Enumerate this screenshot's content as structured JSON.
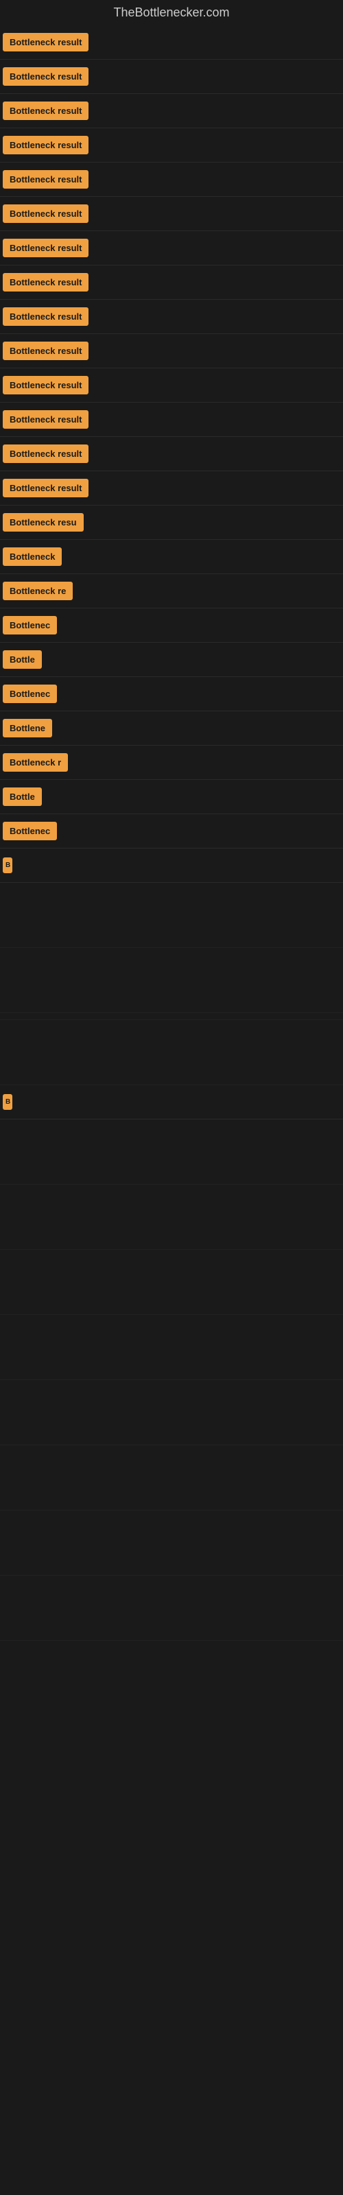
{
  "site": {
    "title": "TheBottlenecker.com"
  },
  "rows": [
    {
      "id": 1,
      "label": "Bottleneck result",
      "badgeClass": "badge-full",
      "spacing": "normal"
    },
    {
      "id": 2,
      "label": "Bottleneck result",
      "badgeClass": "badge-full",
      "spacing": "normal"
    },
    {
      "id": 3,
      "label": "Bottleneck result",
      "badgeClass": "badge-full",
      "spacing": "normal"
    },
    {
      "id": 4,
      "label": "Bottleneck result",
      "badgeClass": "badge-full",
      "spacing": "normal"
    },
    {
      "id": 5,
      "label": "Bottleneck result",
      "badgeClass": "badge-full",
      "spacing": "normal"
    },
    {
      "id": 6,
      "label": "Bottleneck result",
      "badgeClass": "badge-full",
      "spacing": "normal"
    },
    {
      "id": 7,
      "label": "Bottleneck result",
      "badgeClass": "badge-full",
      "spacing": "normal"
    },
    {
      "id": 8,
      "label": "Bottleneck result",
      "badgeClass": "badge-full",
      "spacing": "normal"
    },
    {
      "id": 9,
      "label": "Bottleneck result",
      "badgeClass": "badge-full",
      "spacing": "normal"
    },
    {
      "id": 10,
      "label": "Bottleneck result",
      "badgeClass": "badge-full",
      "spacing": "normal"
    },
    {
      "id": 11,
      "label": "Bottleneck result",
      "badgeClass": "badge-full",
      "spacing": "normal"
    },
    {
      "id": 12,
      "label": "Bottleneck result",
      "badgeClass": "badge-full",
      "spacing": "normal"
    },
    {
      "id": 13,
      "label": "Bottleneck result",
      "badgeClass": "badge-full",
      "spacing": "normal"
    },
    {
      "id": 14,
      "label": "Bottleneck result",
      "badgeClass": "badge-full",
      "spacing": "normal"
    },
    {
      "id": 15,
      "label": "Bottleneck resu",
      "badgeClass": "badge-truncated-1",
      "spacing": "normal"
    },
    {
      "id": 16,
      "label": "Bottleneck",
      "badgeClass": "badge-truncated-3",
      "spacing": "normal"
    },
    {
      "id": 17,
      "label": "Bottleneck re",
      "badgeClass": "badge-truncated-2",
      "spacing": "normal"
    },
    {
      "id": 18,
      "label": "Bottlenec",
      "badgeClass": "badge-truncated-4",
      "spacing": "normal"
    },
    {
      "id": 19,
      "label": "Bottle",
      "badgeClass": "badge-truncated-5",
      "spacing": "normal"
    },
    {
      "id": 20,
      "label": "Bottlenec",
      "badgeClass": "badge-truncated-4",
      "spacing": "normal"
    },
    {
      "id": 21,
      "label": "Bottlene",
      "badgeClass": "badge-truncated-5",
      "spacing": "normal"
    },
    {
      "id": 22,
      "label": "Bottleneck r",
      "badgeClass": "badge-truncated-3",
      "spacing": "normal"
    },
    {
      "id": 23,
      "label": "Bottle",
      "badgeClass": "badge-truncated-6",
      "spacing": "normal"
    },
    {
      "id": 24,
      "label": "Bottlenec",
      "badgeClass": "badge-truncated-4",
      "spacing": "normal"
    },
    {
      "id": 25,
      "label": "B",
      "badgeClass": "badge-tiny",
      "spacing": "normal"
    }
  ],
  "emptyRows": [
    {
      "id": "e1",
      "height": 90
    },
    {
      "id": "e2",
      "height": 90
    },
    {
      "id": "e3",
      "height": 90
    },
    {
      "id": "e4",
      "height": 14
    },
    {
      "id": "e5",
      "height": 90
    },
    {
      "id": "e6",
      "height": 90
    },
    {
      "id": "e7",
      "height": 90
    }
  ],
  "finalRow": {
    "label": "B",
    "badgeClass": "badge-tiny"
  },
  "colors": {
    "badge": "#f0a040",
    "background": "#1a1a1a",
    "text": "#cccccc"
  }
}
